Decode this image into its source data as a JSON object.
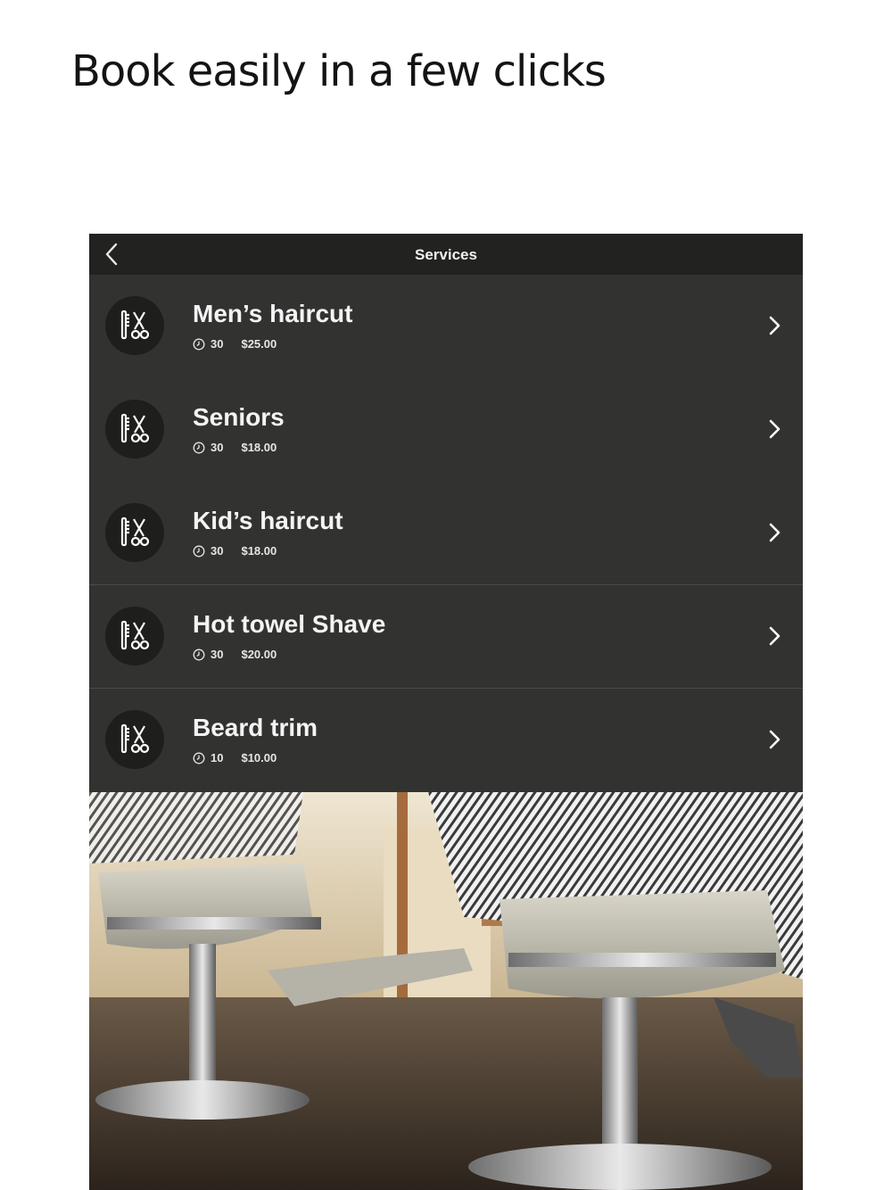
{
  "headline": "Book easily in a few clicks",
  "nav": {
    "title": "Services",
    "back_icon": "chevron-left-icon"
  },
  "services": [
    {
      "name": "Men’s haircut",
      "duration": "30",
      "price": "$25.00"
    },
    {
      "name": "Seniors",
      "duration": "30",
      "price": "$18.00"
    },
    {
      "name": "Kid’s haircut",
      "duration": "30",
      "price": "$18.00"
    },
    {
      "name": "Hot towel Shave",
      "duration": "30",
      "price": "$20.00"
    },
    {
      "name": "Beard trim",
      "duration": "10",
      "price": "$10.00"
    }
  ],
  "icons": {
    "service": "comb-scissors-icon",
    "duration": "clock-icon",
    "row_action": "chevron-right-icon"
  },
  "colors": {
    "navbar": "#222321",
    "list_background": "#323331",
    "text": "#f4f4f4"
  }
}
